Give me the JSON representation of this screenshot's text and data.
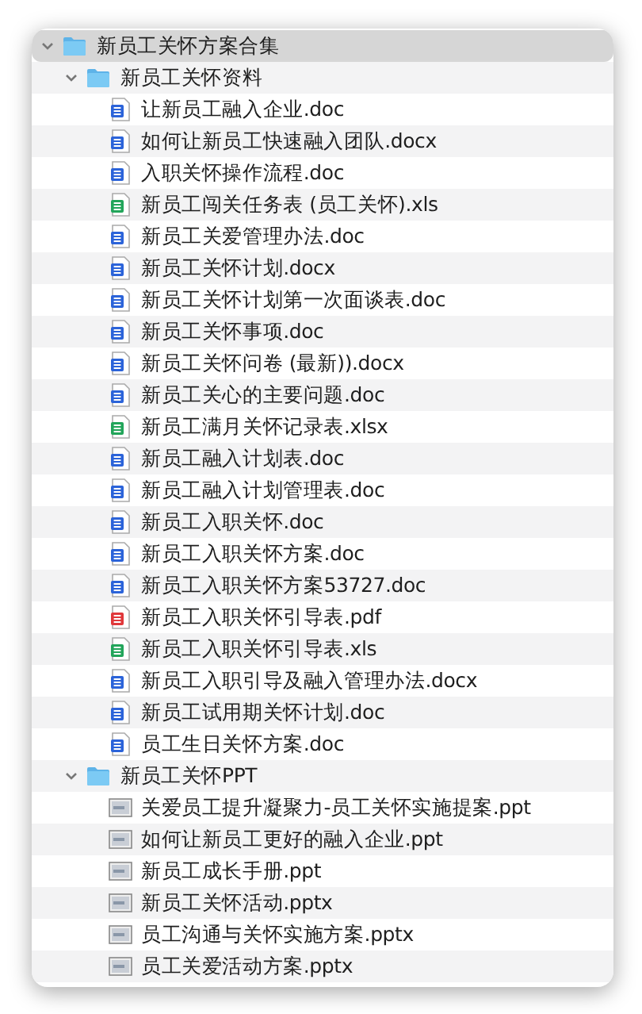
{
  "tree": [
    {
      "kind": "folder",
      "name": "新员工关怀方案合集",
      "expanded": true,
      "selected": true,
      "children": [
        {
          "kind": "folder",
          "name": "新员工关怀资料",
          "expanded": true,
          "selected": false,
          "children": [
            {
              "kind": "word",
              "name": "让新员工融入企业.doc",
              "selected": false
            },
            {
              "kind": "word",
              "name": "如何让新员工快速融入团队.docx",
              "selected": false
            },
            {
              "kind": "word",
              "name": "入职关怀操作流程.doc",
              "selected": false
            },
            {
              "kind": "excel",
              "name": "新员工闯关任务表 (员工关怀).xls",
              "selected": false
            },
            {
              "kind": "word",
              "name": "新员工关爱管理办法.doc",
              "selected": false
            },
            {
              "kind": "word",
              "name": "新员工关怀计划.docx",
              "selected": false
            },
            {
              "kind": "word",
              "name": "新员工关怀计划第一次面谈表.doc",
              "selected": false
            },
            {
              "kind": "word",
              "name": "新员工关怀事项.doc",
              "selected": false
            },
            {
              "kind": "word",
              "name": "新员工关怀问卷 (最新)).docx",
              "selected": false
            },
            {
              "kind": "word",
              "name": "新员工关心的主要问题.doc",
              "selected": false
            },
            {
              "kind": "excel",
              "name": "新员工满月关怀记录表.xlsx",
              "selected": false
            },
            {
              "kind": "word",
              "name": "新员工融入计划表.doc",
              "selected": false
            },
            {
              "kind": "word",
              "name": "新员工融入计划管理表.doc",
              "selected": false
            },
            {
              "kind": "word",
              "name": "新员工入职关怀.doc",
              "selected": false
            },
            {
              "kind": "word",
              "name": "新员工入职关怀方案.doc",
              "selected": false
            },
            {
              "kind": "word",
              "name": "新员工入职关怀方案53727.doc",
              "selected": false
            },
            {
              "kind": "pdf",
              "name": "新员工入职关怀引导表.pdf",
              "selected": false
            },
            {
              "kind": "excel",
              "name": "新员工入职关怀引导表.xls",
              "selected": false
            },
            {
              "kind": "word",
              "name": "新员工入职引导及融入管理办法.docx",
              "selected": false
            },
            {
              "kind": "word",
              "name": "新员工试用期关怀计划.doc",
              "selected": false
            },
            {
              "kind": "word",
              "name": "员工生日关怀方案.doc",
              "selected": false
            }
          ]
        },
        {
          "kind": "folder",
          "name": "新员工关怀PPT",
          "expanded": true,
          "selected": false,
          "children": [
            {
              "kind": "slides",
              "name": "关爱员工提升凝聚力-员工关怀实施提案.ppt",
              "selected": false
            },
            {
              "kind": "slides",
              "name": "如何让新员工更好的融入企业.ppt",
              "selected": false
            },
            {
              "kind": "slides",
              "name": "新员工成长手册.ppt",
              "selected": false
            },
            {
              "kind": "slides",
              "name": "新员工关怀活动.pptx",
              "selected": false
            },
            {
              "kind": "slides",
              "name": "员工沟通与关怀实施方案.pptx",
              "selected": false
            },
            {
              "kind": "slides",
              "name": "员工关爱活动方案.pptx",
              "selected": false
            }
          ]
        }
      ]
    }
  ]
}
